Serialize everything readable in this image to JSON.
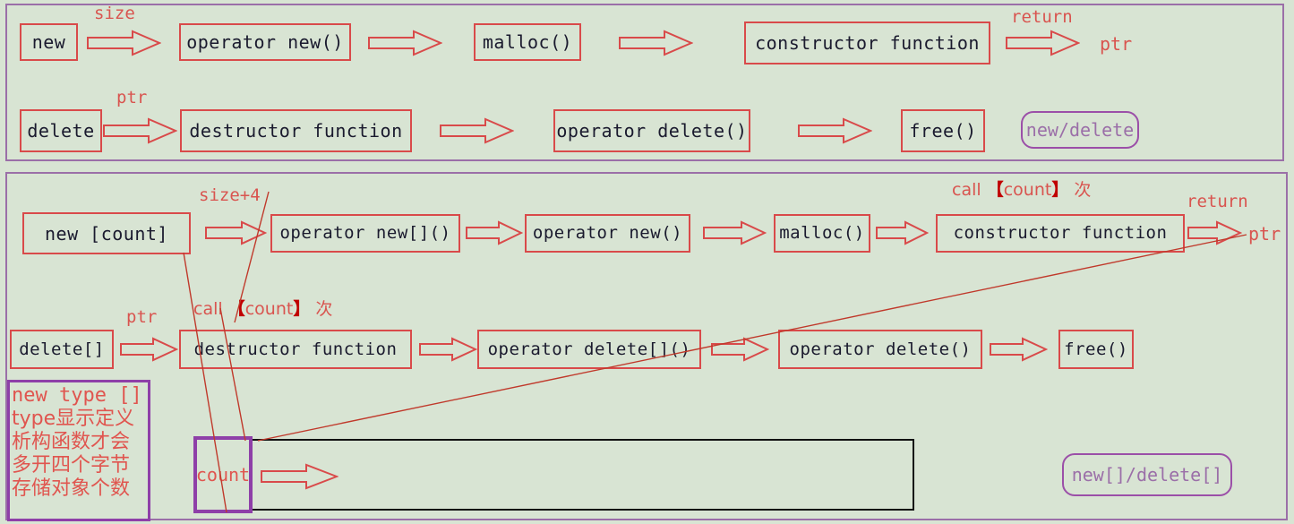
{
  "diagram": {
    "title": "new/delete and new[]/delete[] call flow",
    "background_color": "#d8e4d3",
    "panel_border_color": "#9b6fa8",
    "box_border_color": "#d94a4a",
    "annotation_color": "#d9544f",
    "note_border_color": "#8e3fa8"
  },
  "panel_new_delete": {
    "tag": "new/delete",
    "row_new": {
      "boxes": [
        {
          "label": "new"
        },
        {
          "label": "operator new()"
        },
        {
          "label": "malloc()"
        },
        {
          "label": "constructor function"
        }
      ],
      "arrow_labels": {
        "first": "size",
        "last": "return"
      },
      "result": "ptr"
    },
    "row_delete": {
      "boxes": [
        {
          "label": "delete"
        },
        {
          "label": "destructor function"
        },
        {
          "label": "operator delete()"
        },
        {
          "label": "free()"
        }
      ],
      "arrow_labels": {
        "first": "ptr"
      }
    }
  },
  "panel_new_array": {
    "tag": "new[]/delete[]",
    "row_new": {
      "boxes": [
        {
          "label": "new [count]"
        },
        {
          "label": "operator new[]()"
        },
        {
          "label": "operator new()"
        },
        {
          "label": "malloc()"
        },
        {
          "label": "constructor function"
        }
      ],
      "arrow_labels": {
        "first": "size+4",
        "last": "return"
      },
      "call_note": {
        "prefix": "call",
        "bracket_open": "【",
        "count": "count",
        "bracket_close": "】",
        "suffix": "次"
      },
      "result": "ptr"
    },
    "row_delete": {
      "boxes": [
        {
          "label": "delete[]"
        },
        {
          "label": "destructor function"
        },
        {
          "label": "operator delete[]()"
        },
        {
          "label": "operator delete()"
        },
        {
          "label": "free()"
        }
      ],
      "arrow_labels": {
        "first": "ptr"
      },
      "call_note": {
        "prefix": "call",
        "bracket_open": "【",
        "count": "count",
        "bracket_close": "】",
        "suffix": "次"
      }
    },
    "note": {
      "lines": [
        "new type []",
        "type显示定义",
        "析构函数才会",
        "多开四个字节",
        "存储对象个数"
      ]
    },
    "memory_layout": {
      "count_cell": "count",
      "objects_cell": ""
    }
  }
}
